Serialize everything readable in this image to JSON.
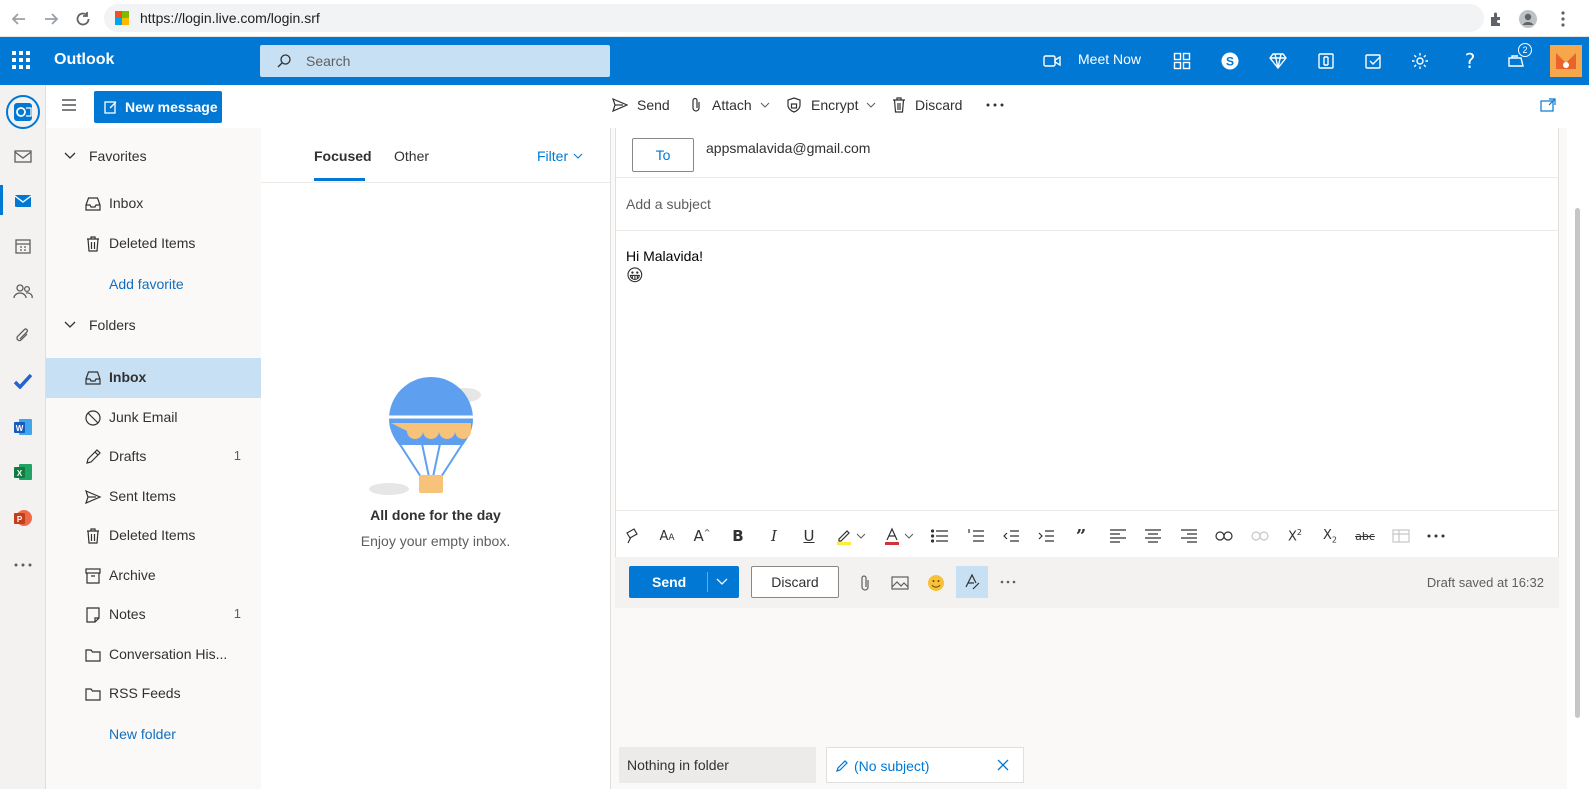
{
  "browser": {
    "url": "https://login.live.com/login.srf"
  },
  "header": {
    "app_name": "Outlook",
    "search_placeholder": "Search",
    "meet_now_label": "Meet Now",
    "notification_count": "2"
  },
  "command_bar": {
    "new_message_label": "New message",
    "send_label": "Send",
    "attach_label": "Attach",
    "encrypt_label": "Encrypt",
    "discard_label": "Discard"
  },
  "nav": {
    "favorites_label": "Favorites",
    "favorites": [
      {
        "label": "Inbox",
        "icon": "inbox-icon"
      },
      {
        "label": "Deleted Items",
        "icon": "trash-icon"
      }
    ],
    "add_favorite_label": "Add favorite",
    "folders_label": "Folders",
    "folders": [
      {
        "label": "Inbox",
        "count": "",
        "icon": "inbox-icon",
        "selected": true
      },
      {
        "label": "Junk Email",
        "count": "",
        "icon": "block-icon"
      },
      {
        "label": "Drafts",
        "count": "1",
        "icon": "pencil-icon"
      },
      {
        "label": "Sent Items",
        "count": "",
        "icon": "send-icon"
      },
      {
        "label": "Deleted Items",
        "count": "",
        "icon": "trash-icon"
      },
      {
        "label": "Archive",
        "count": "",
        "icon": "archive-icon"
      },
      {
        "label": "Notes",
        "count": "1",
        "icon": "note-icon"
      },
      {
        "label": "Conversation His...",
        "count": "",
        "icon": "folder-icon"
      },
      {
        "label": "RSS Feeds",
        "count": "",
        "icon": "folder-icon"
      }
    ],
    "new_folder_label": "New folder"
  },
  "message_list": {
    "tabs": [
      "Focused",
      "Other"
    ],
    "filter_label": "Filter",
    "empty_title": "All done for the day",
    "empty_subtitle": "Enjoy your empty inbox."
  },
  "compose": {
    "to_button_label": "To",
    "to_value": "appsmalavida@gmail.com",
    "subject_placeholder": "Add a subject",
    "body_line1": "Hi Malavida!",
    "body_emoji": "😀",
    "send_label": "Send",
    "discard_label": "Discard",
    "draft_status": "Draft saved at 16:32"
  },
  "bottom_tabs": {
    "folder_tab": "Nothing in folder",
    "draft_tab": "(No subject)"
  },
  "colors": {
    "brand_blue": "#0078d4",
    "selected_bg": "#c7e0f4"
  }
}
